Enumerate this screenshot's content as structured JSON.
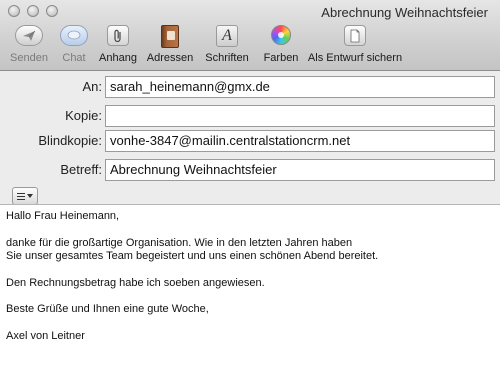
{
  "window": {
    "title": "Abrechnung Weihnachtsfeier"
  },
  "toolbar": {
    "send_label": "Senden",
    "chat_label": "Chat",
    "attachment_label": "Anhang",
    "addresses_label": "Adressen",
    "fonts_label": "Schriften",
    "colors_label": "Farben",
    "save_draft_label": "Als Entwurf sichern"
  },
  "fields": {
    "to_label": "An:",
    "to_value": "sarah_heinemann@gmx.de",
    "cc_label": "Kopie:",
    "cc_value": "",
    "bcc_label": "Blindkopie:",
    "bcc_value": "vonhe-3847@mailin.centralstationcrm.net",
    "subject_label": "Betreff:",
    "subject_value": "Abrechnung Weihnachtsfeier"
  },
  "message": {
    "greeting": "Hallo Frau Heinemann,",
    "paragraph1": "danke für die großartige Organisation. Wie in den letzten Jahren haben\nSie unser gesamtes Team begeistert und uns einen schönen Abend bereitet.",
    "paragraph2": "Den Rechnungsbetrag habe ich soeben angewiesen.",
    "closing": "Beste Grüße und Ihnen eine gute Woche,",
    "signature": "Axel von Leitner"
  },
  "icons": {
    "send": "paper-plane-icon",
    "chat": "chat-bubble-icon",
    "attachment": "paperclip-icon",
    "addresses": "address-book-icon",
    "fonts": "font-icon",
    "colors": "color-wheel-icon",
    "save_draft": "draft-document-icon",
    "format": "format-list-icon"
  }
}
